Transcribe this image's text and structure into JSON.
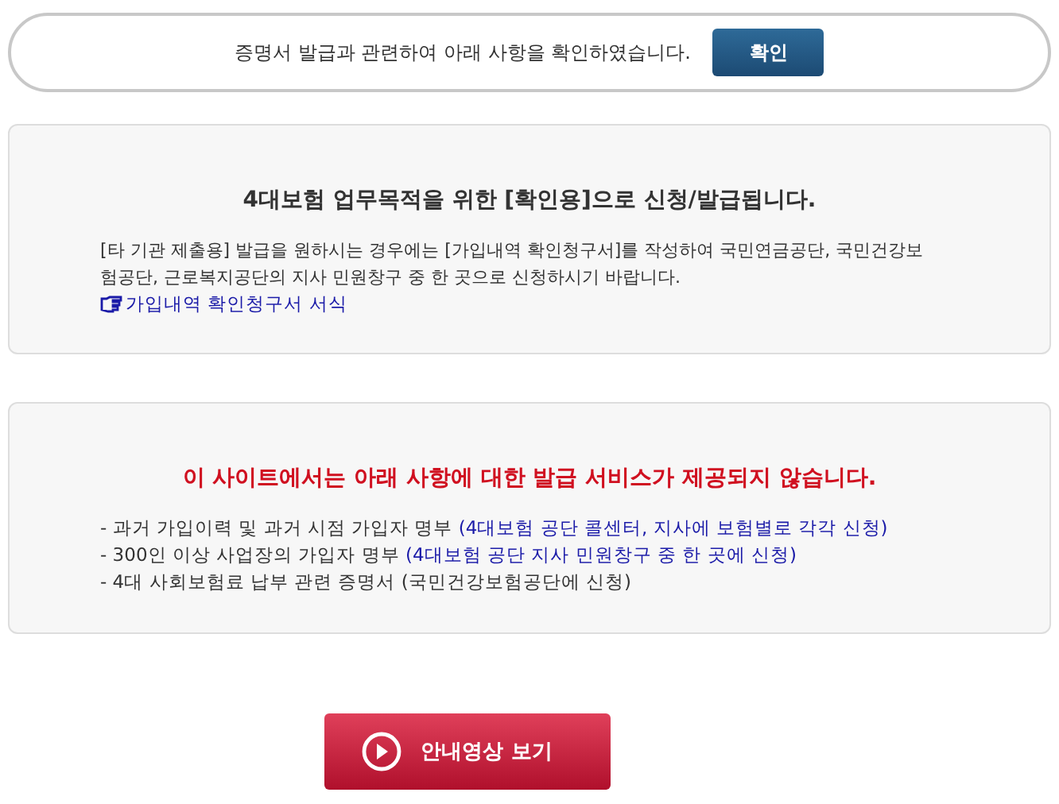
{
  "confirm_bar": {
    "message": "증명서 발급과 관련하여 아래 사항을 확인하였습니다.",
    "button": "확인"
  },
  "notice": {
    "heading": "4대보험 업무목적을 위한 [확인용]으로 신청/발급됩니다.",
    "body": "[타 기관 제출용] 발급을 원하시는 경우에는 [가입내역 확인청구서]를 작성하여 국민연금공단, 국민건강보험공단, 근로복지공단의 지사 민원창구 중 한 곳으로 신청하시기 바랍니다.",
    "link": "가입내역 확인청구서 서식"
  },
  "not_provided": {
    "heading": "이 사이트에서는 아래 사항에 대한 발급 서비스가 제공되지 않습니다.",
    "items": [
      {
        "text": "- 과거 가입이력 및 과거 시점 가입자 명부",
        "note": "(4대보험 공단 콜센터, 지사에 보험별로 각각 신청)",
        "kind": "highlight"
      },
      {
        "text": "- 300인 이상 사업장의 가입자 명부",
        "note": "(4대보험 공단 지사 민원창구 중 한 곳에 신청)",
        "kind": "highlight"
      },
      {
        "text": "- 4대 사회보험료 납부 관련 증명서",
        "note": "(국민건강보험공단에 신청)",
        "kind": "plain"
      }
    ]
  },
  "video_button": "안내영상 보기"
}
